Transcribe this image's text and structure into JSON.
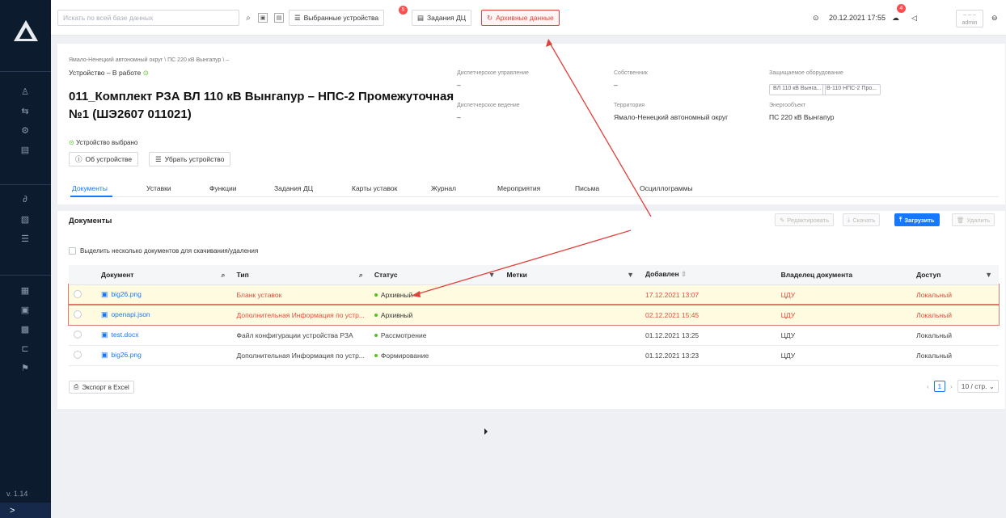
{
  "sidebar": {
    "icons": [
      "logo-icon",
      "user-icon",
      "transfer-icon",
      "settings-icon",
      "document-icon",
      "link-icon",
      "file-icon",
      "list-icon",
      "report-icon",
      "calendar-icon",
      "grid-icon",
      "folder-icon",
      "flag-icon"
    ],
    "version": "v. 1.14",
    "expand_glyph": ">"
  },
  "topbar": {
    "search_placeholder": "Искать по всей базе данных",
    "favorites_label": "Выбранные устройства",
    "favorites_badge": "5",
    "tasks_label": "Задания ДЦ",
    "archive_label": "Архивные данные",
    "datetime": "20.12.2021 17:55",
    "cloud_badge": "4",
    "user_dash": "– – –",
    "user_name": "admin"
  },
  "device": {
    "breadcrumb": "Ямало-Ненецкий автономный округ \\ ПС 220 кВ Вынгапур \\ –",
    "status_prefix": "Устройство – ",
    "status": "В работе",
    "title": "011_Комплект РЗА ВЛ 110 кВ Вынгапур – НПС-2 Промежуточная №1 (ШЭ2607 011021)",
    "selected_text": "Устройство выбрано",
    "about_button": "Об устройстве",
    "remove_button": "Убрать устройство"
  },
  "info": {
    "dispatch_control_label": "Диспетчерское управление",
    "dispatch_control_value": "–",
    "dispatch_lead_label": "Диспетчерское ведение",
    "dispatch_lead_value": "–",
    "owner_label": "Собственник",
    "owner_value": "–",
    "territory_label": "Территория",
    "territory_value": "Ямало-Ненецкий автономный округ",
    "protected_label": "Защищаемое оборудование",
    "protected_chips": [
      "ВЛ 110 кВ Вынга...",
      "В-110 НПС-2 Про..."
    ],
    "energy_label": "Энергообъект",
    "energy_value": "ПС 220 кВ Вынгапур"
  },
  "tabs": [
    "Документы",
    "Уставки",
    "Функции",
    "Задания ДЦ",
    "Карты уставок",
    "Журнал",
    "Мероприятия",
    "Письма",
    "Осциллограммы"
  ],
  "documents": {
    "section_title": "Документы",
    "edit": "Редактировать",
    "download": "Скачать",
    "upload": "Загрузить",
    "delete": "Удалить",
    "multi_select": "Выделить несколько документов для скачивания/удаления",
    "columns": [
      "Документ",
      "Тип",
      "Статус",
      "Метки",
      "Добавлен",
      "Владелец документа",
      "Доступ"
    ],
    "rows": [
      {
        "doc": "big26.png",
        "type": "Бланк уставок",
        "status": "Архивный",
        "tags": "",
        "added": "17.12.2021 13:07",
        "owner": "ЦДУ",
        "access": "Локальный"
      },
      {
        "doc": "openapi.json",
        "type": "Дополнительная Информация по устр...",
        "status": "Архивный",
        "tags": "",
        "added": "02.12.2021 15:45",
        "owner": "ЦДУ",
        "access": "Локальный"
      },
      {
        "doc": "test.docx",
        "type": "Файл конфигурации устройства РЗА",
        "status": "Рассмотрение",
        "tags": "",
        "added": "01.12.2021 13:25",
        "owner": "ЦДУ",
        "access": "Локальный"
      },
      {
        "doc": "big26.png",
        "type": "Дополнительная Информация по устр...",
        "status": "Формирование",
        "tags": "",
        "added": "01.12.2021 13:23",
        "owner": "ЦДУ",
        "access": "Локальный"
      }
    ],
    "export": "Экспорт в Excel",
    "page": "1",
    "page_size": "10 / стр."
  },
  "colors": {
    "sidebar": "#0d1b2e",
    "accent": "#1677ff",
    "archive": "#e0413a",
    "highlight": "#fffbe0"
  }
}
